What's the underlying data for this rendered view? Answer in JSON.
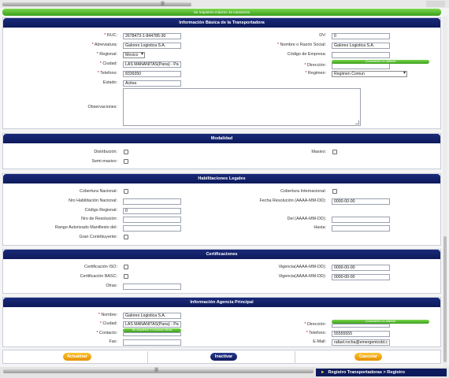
{
  "top_notice": "Se requieren máximo 15 caracteres",
  "basic": {
    "title": "Información Básica de la Transportadora",
    "rut_label": "RUC:",
    "rut_value": "2678473-1-844785-30",
    "dv_label": "DV:",
    "dv_value": "0",
    "abbr_label": "Abreviatura:",
    "abbr_value": "Galores Logistica S.A.",
    "name_label": "Nombre o Razón Social:",
    "name_value": "Galores Logistica S.A.",
    "regional_label": "Regional:",
    "regional_value": "Mexico",
    "company_code_label": "Código de Empresa:",
    "company_code_value": "",
    "city_label": "Ciudad:",
    "city_value": "LAS MAÑANITAS(Pana) - Pa",
    "address_label": "Dirección:",
    "address_notice": "¡Caracteres no válidos!",
    "phone_label": "Telefono:",
    "phone_value": "8339350",
    "regime_label": "Regimen:",
    "regime_value": "Regimen Comun",
    "status_label": "Estado:",
    "status_value": "Activa",
    "notes_label": "Observaciones:"
  },
  "modalidad": {
    "title": "Modalidad",
    "distribucion_label": "Distribución:",
    "masivo_label": "Masivo:",
    "semimasivo_label": "Semi-masivo:"
  },
  "legal": {
    "title": "Habilitaciones Legales",
    "cob_nac_label": "Cobertura Nacional:",
    "cob_int_label": "Cobertura Internacional:",
    "nro_hab_label": "Nro Habilitación Nacional:",
    "fecha_res_label": "Fecha Resolución (AAAA-MM-DD):",
    "fecha_res_value": "0000-00-00",
    "cod_regional_label": "Código Regional:",
    "cod_regional_value": "0",
    "nro_res_label": "Nro de Resolución:",
    "del_label": "Del (AAAA-MM-DD):",
    "rango_label": "Rango Autorizado Manifiesto del:",
    "hasta_label": "Hasta:",
    "gran_contrib_label": "Gran Contribuyente:"
  },
  "cert": {
    "title": "Certificaciones",
    "iso_label": "Certificación ISO:",
    "iso_vig_label": "Vigencia(AAAA-MM-DD):",
    "iso_vig_value": "0000-00-00",
    "basc_label": "Certificación BASC:",
    "basc_vig_label": "Vigencia(AAAA-MM-DD):",
    "basc_vig_value": "0000-00-00",
    "otras_label": "Otras:"
  },
  "agency": {
    "title": "Información Agencia Principal",
    "name_label": "Nombre:",
    "name_value": "Galores Logistica S.A.",
    "city_label": "Ciudad:",
    "city_value": "LAS MAÑANITAS(Pana) - Pa",
    "address_label": "Dirección:",
    "address_notice": "¡Caracteres no válidos!",
    "contact_label": "Contacto:",
    "contact_notice": "Se requieren 4 numeros letras",
    "phone_label": "Telefono:",
    "phone_value": "55555555",
    "fax_label": "Fax:",
    "email_label": "E-Mail:",
    "email_value": "rafael.rocha@emergentcold.c"
  },
  "buttons": {
    "update": "Actualizar",
    "inactivate": "Inactivar",
    "cancel": "Cancelar"
  },
  "breadcrumb": "Registro Transportadoras > Registro",
  "colors": {
    "header_navy": "#0d1a5c",
    "notice_green": "#3b9e1d",
    "button_orange": "#e49000"
  }
}
